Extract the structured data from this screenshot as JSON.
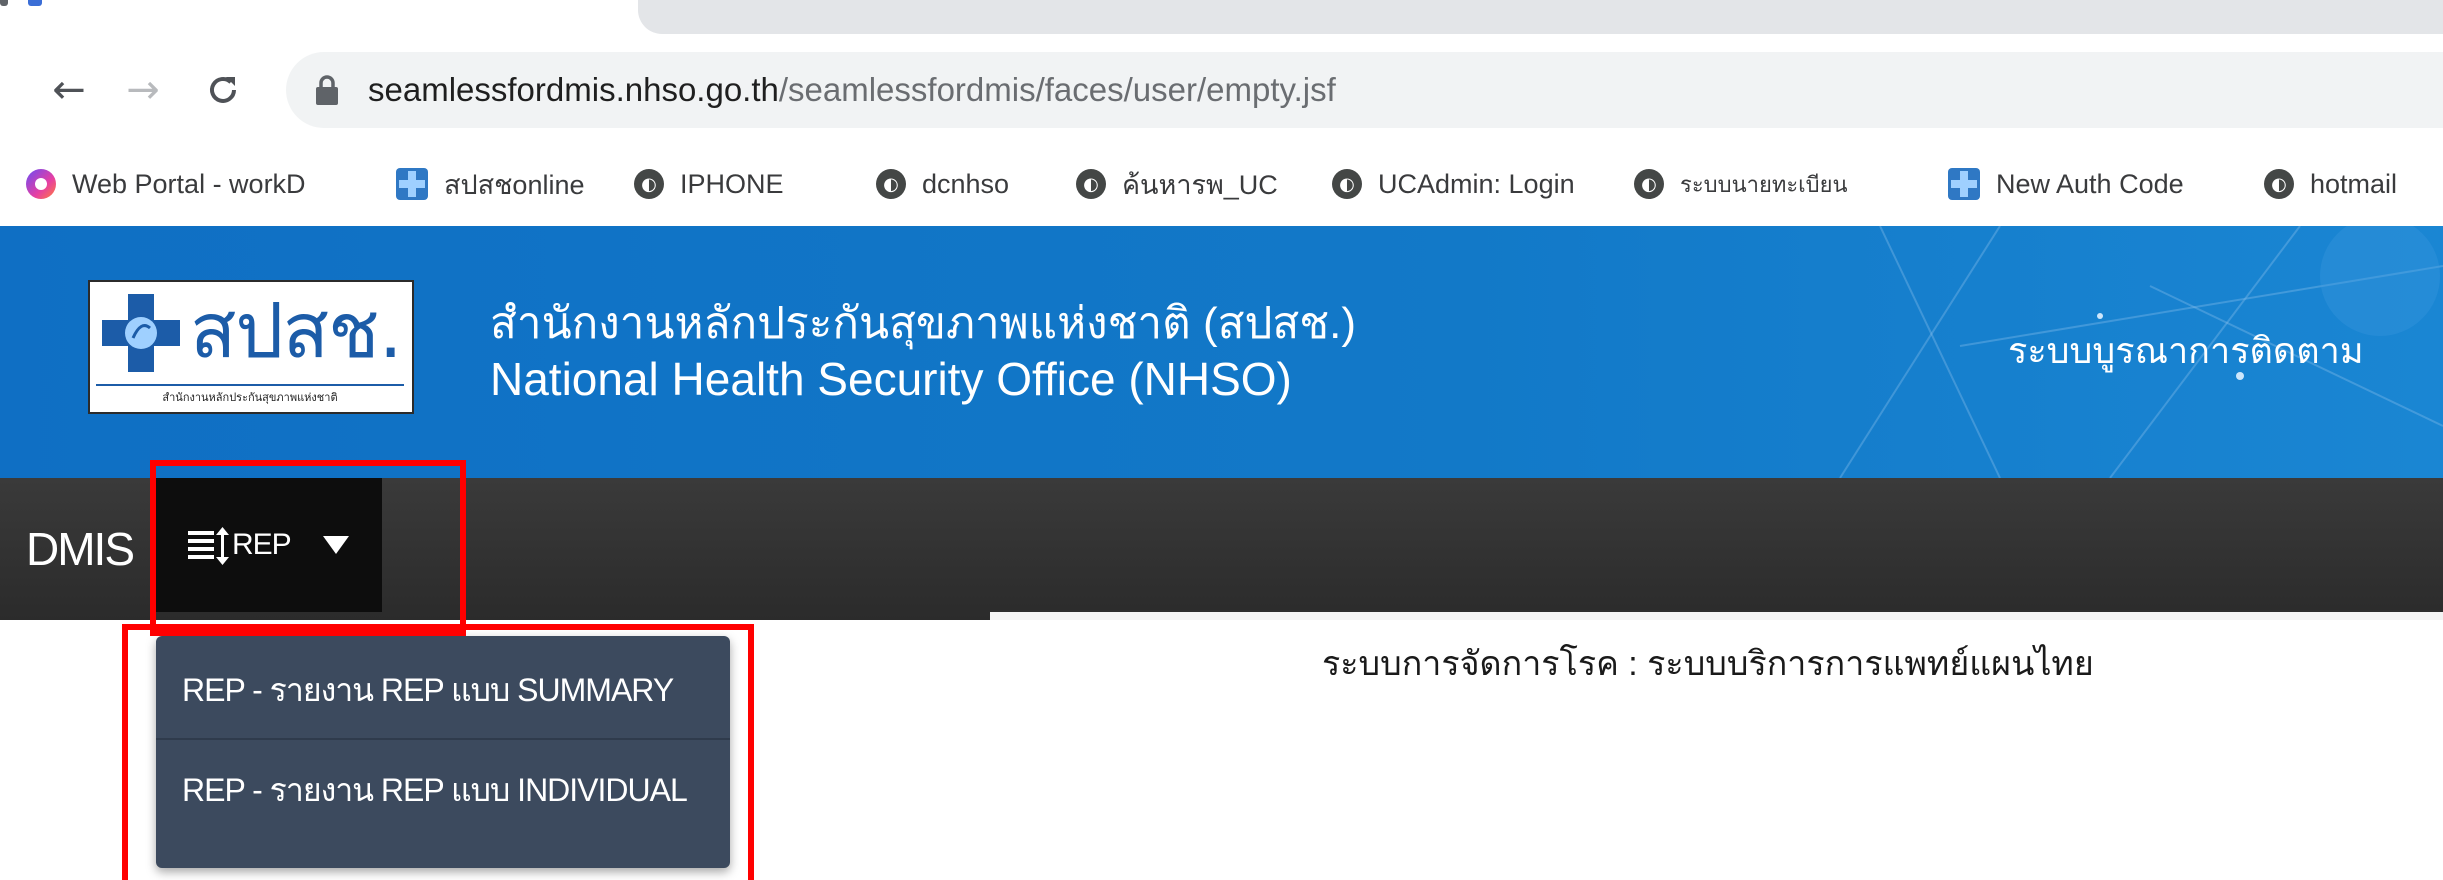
{
  "browser": {
    "url_host": "seamlessfordmis.nhso.go.th",
    "url_path": "/seamlessfordmis/faces/user/empty.jsf",
    "bookmarks": [
      {
        "label": "Web Portal - workD",
        "icon": "portal-icon"
      },
      {
        "label": "สปสชonline",
        "icon": "nhso-favicon"
      },
      {
        "label": "IPHONE",
        "icon": "globe-icon"
      },
      {
        "label": "dcnhso",
        "icon": "globe-icon"
      },
      {
        "label": "ค้นหารพ_UC",
        "icon": "globe-icon"
      },
      {
        "label": "UCAdmin: Login",
        "icon": "globe-icon"
      },
      {
        "label": "ระบบนายทะเบียน",
        "icon": "globe-icon"
      },
      {
        "label": "New Auth Code",
        "icon": "nhso-favicon"
      },
      {
        "label": "hotmail",
        "icon": "globe-icon"
      }
    ]
  },
  "header": {
    "logo_text": "สปสช.",
    "logo_subtext": "สำนักงานหลักประกันสุขภาพแห่งชาติ",
    "org_name_th": "สำนักงานหลักประกันสุขภาพแห่งชาติ (สปสช.)",
    "org_name_en": "National Health Security Office (NHSO)",
    "system_title": "ระบบบูรณาการติดตาม"
  },
  "nav": {
    "brand": "DMIS",
    "menu_label": "REP",
    "dropdown_items": [
      "REP - รายงาน REP แบบ SUMMARY",
      "REP - รายงาน REP แบบ INDIVIDUAL"
    ]
  },
  "content": {
    "heading": "ระบบการจัดการโรค : ระบบบริการการแพทย์แผนไทย"
  },
  "colors": {
    "header_blue": "#1279c8",
    "nav_dark": "#2b2b2b",
    "dropdown_bg": "#3c4a5e",
    "annotation_red": "#ff0000"
  }
}
